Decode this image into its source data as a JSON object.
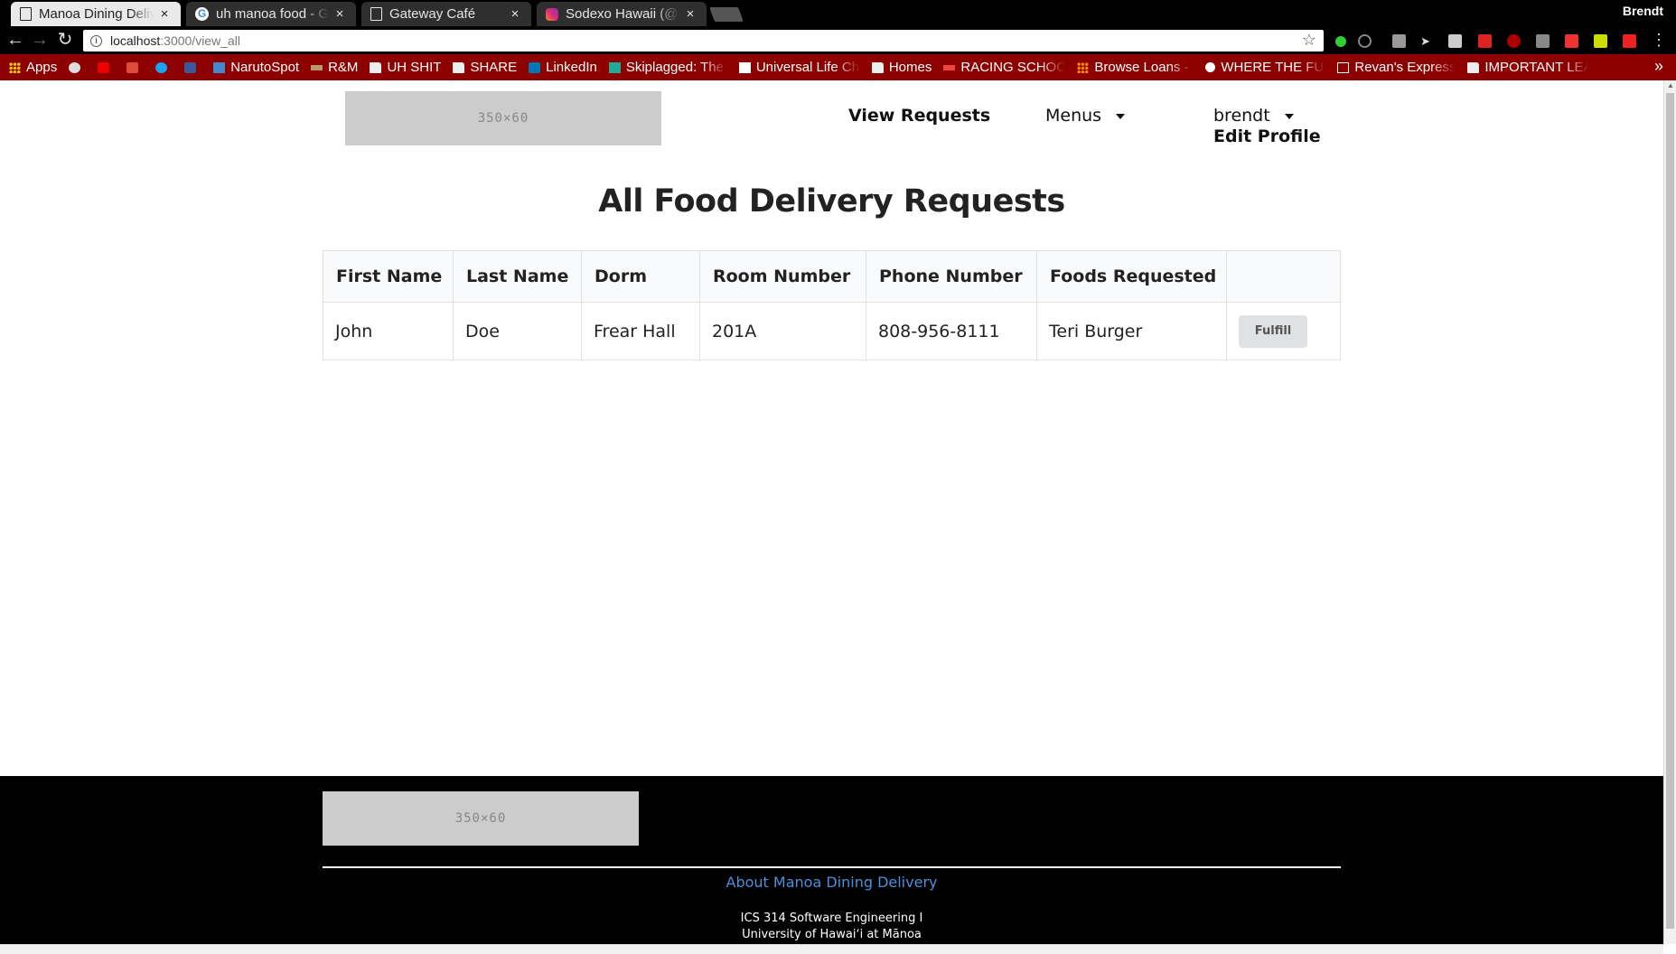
{
  "browser": {
    "tabs": [
      {
        "title": "Manoa Dining Deliv",
        "icon": "page-icon",
        "active": true
      },
      {
        "title": "uh manoa food - Go",
        "icon": "google-icon",
        "active": false
      },
      {
        "title": "Gateway Café",
        "icon": "page-icon",
        "active": false
      },
      {
        "title": "Sodexo Hawaii (@s",
        "icon": "instagram-icon",
        "active": false
      }
    ],
    "profile": "Brendt",
    "url_host": "localhost",
    "url_path": ":3000/view_all",
    "bookmarks": [
      {
        "label": "Apps",
        "icon": "apps-icon"
      },
      {
        "label": "",
        "icon": "reddit-icon"
      },
      {
        "label": "",
        "icon": "youtube-icon"
      },
      {
        "label": "",
        "icon": "google-plus-icon"
      },
      {
        "label": "",
        "icon": "twitter-icon"
      },
      {
        "label": "",
        "icon": "facebook-icon"
      },
      {
        "label": "NarutoSpot",
        "icon": "naruto-icon"
      },
      {
        "label": "R&M",
        "icon": "rm-icon"
      },
      {
        "label": "UH SHIT",
        "icon": "folder-icon"
      },
      {
        "label": "SHARE",
        "icon": "folder-icon"
      },
      {
        "label": "LinkedIn",
        "icon": "linkedin-icon"
      },
      {
        "label": "Skiplagged: The c",
        "icon": "skiplagged-icon"
      },
      {
        "label": "Universal Life Ch",
        "icon": "ulc-icon"
      },
      {
        "label": "Homes",
        "icon": "folder-icon"
      },
      {
        "label": "RACING SCHOOL",
        "icon": "racing-icon"
      },
      {
        "label": "Browse Loans - L",
        "icon": "loans-icon"
      },
      {
        "label": "WHERE THE FUC",
        "icon": "circle-icon"
      },
      {
        "label": "Revan's Express",
        "icon": "page-icon"
      },
      {
        "label": "IMPORTANT LEA",
        "icon": "folder-icon"
      }
    ]
  },
  "header": {
    "logo_text": "350×60",
    "nav_view_requests": "View Requests",
    "nav_menus": "Menus",
    "user_name": "brendt",
    "edit_profile": "Edit Profile"
  },
  "main": {
    "title": "All Food Delivery Requests",
    "columns": [
      "First Name",
      "Last Name",
      "Dorm",
      "Room Number",
      "Phone Number",
      "Foods Requested",
      ""
    ],
    "rows": [
      {
        "first_name": "John",
        "last_name": "Doe",
        "dorm": "Frear Hall",
        "room": "201A",
        "phone": "808-956-8111",
        "foods": "Teri Burger",
        "action": "Fulfill"
      }
    ]
  },
  "footer": {
    "logo_text": "350×60",
    "about_link": "About Manoa Dining Delivery",
    "line1": "ICS 314 Software Engineering I",
    "line2": "University of Hawaiʻi at Mānoa"
  },
  "colors": {
    "bookmark_bar": "#8c0000",
    "link_blue": "#4a90d9",
    "footer_bg": "#000000"
  }
}
